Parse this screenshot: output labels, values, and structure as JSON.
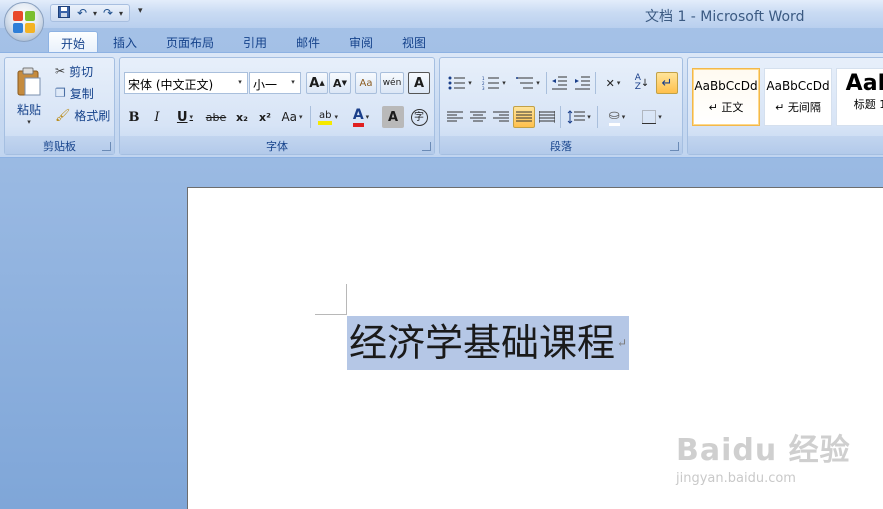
{
  "window": {
    "title": "文档 1 - Microsoft Word"
  },
  "quick_access": {
    "save_icon": "save-icon",
    "undo_icon": "undo-icon",
    "redo_icon": "redo-icon",
    "more": "▾"
  },
  "tabs": [
    {
      "label": "开始",
      "active": true
    },
    {
      "label": "插入"
    },
    {
      "label": "页面布局"
    },
    {
      "label": "引用"
    },
    {
      "label": "邮件"
    },
    {
      "label": "审阅"
    },
    {
      "label": "视图"
    }
  ],
  "clipboard": {
    "label": "剪贴板",
    "paste": "粘贴",
    "cut": "剪切",
    "copy": "复制",
    "format_painter": "格式刷"
  },
  "font": {
    "label": "字体",
    "family": "宋体 (中文正文)",
    "size": "小一",
    "grow": "A",
    "shrink": "A",
    "clear": "Aa",
    "phonetic": "wén",
    "border": "A",
    "bold": "B",
    "italic": "I",
    "underline": "U",
    "strike": "abe",
    "subscript": "x₂",
    "superscript": "x²",
    "change_case": "Aa",
    "highlight": "ab",
    "font_color": "A",
    "shading": "A",
    "enclose": "字"
  },
  "paragraph": {
    "label": "段落"
  },
  "styles": [
    {
      "sample": "AaBbCcDd",
      "name": "↵ 正文",
      "selected": true
    },
    {
      "sample": "AaBbCcDd",
      "name": "↵ 无间隔"
    },
    {
      "sample": "AaB",
      "name": "标题 1"
    }
  ],
  "document": {
    "text": "经济学基础课程",
    "pilcrow": "↵"
  },
  "watermark": {
    "main": "Baidu 经验",
    "sub": "jingyan.baidu.com"
  },
  "colors": {
    "accent": "#15428b",
    "selection": "#b5c7e6",
    "highlight": "#f5e900",
    "font_color": "#e02020"
  }
}
